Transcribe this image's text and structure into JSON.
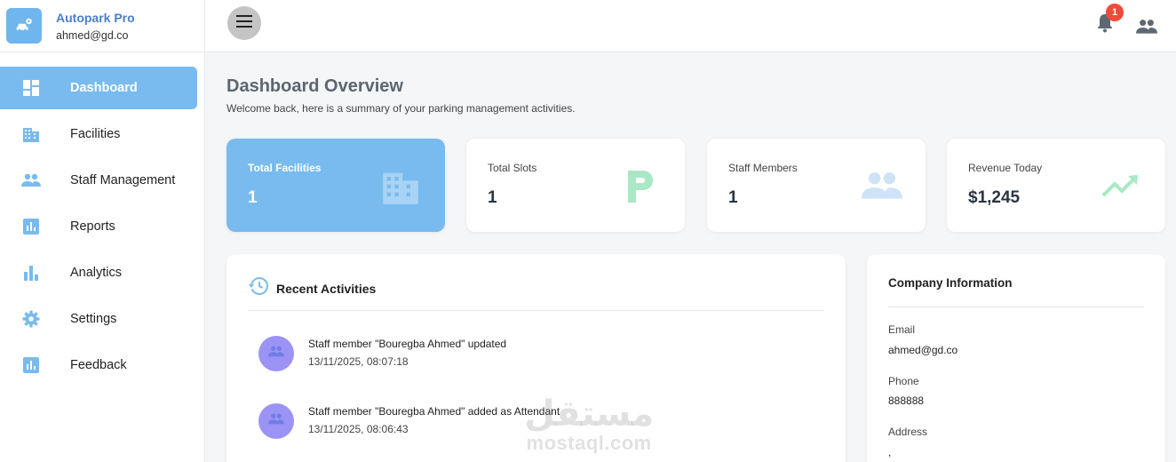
{
  "brand": {
    "name": "Autopark Pro",
    "email": "ahmed@gd.co",
    "logo_icon": "car-settings-icon"
  },
  "sidebar": {
    "items": [
      {
        "label": "Dashboard",
        "icon": "dashboard-icon",
        "active": true
      },
      {
        "label": "Facilities",
        "icon": "building-icon",
        "active": false
      },
      {
        "label": "Staff Management",
        "icon": "people-icon",
        "active": false
      },
      {
        "label": "Reports",
        "icon": "bar-chart-box-icon",
        "active": false
      },
      {
        "label": "Analytics",
        "icon": "bar-chart-icon",
        "active": false
      },
      {
        "label": "Settings",
        "icon": "gear-icon",
        "active": false
      },
      {
        "label": "Feedback",
        "icon": "bar-chart-box-icon",
        "active": false
      }
    ]
  },
  "topbar": {
    "menu_icon": "hamburger-menu-icon",
    "notification_count": "1",
    "notification_icon": "bell-icon",
    "account_icon": "people-icon"
  },
  "header": {
    "title": "Dashboard Overview",
    "subtitle": "Welcome back, here is a summary of your parking management activities."
  },
  "stats": [
    {
      "label": "Total Facilities",
      "value": "1",
      "icon": "building-icon"
    },
    {
      "label": "Total Slots",
      "value": "1",
      "icon": "parking-icon"
    },
    {
      "label": "Staff Members",
      "value": "1",
      "icon": "people-icon"
    },
    {
      "label": "Revenue Today",
      "value": "$1,245",
      "icon": "trending-up-icon"
    }
  ],
  "activities": {
    "title": "Recent Activities",
    "icon": "history-icon",
    "items": [
      {
        "message": "Staff member \"Bouregba Ahmed\" updated",
        "time": "13/11/2025, 08:07:18",
        "icon": "people-icon"
      },
      {
        "message": "Staff member \"Bouregba Ahmed\" added as Attendant",
        "time": "13/11/2025, 08:06:43",
        "icon": "people-icon"
      }
    ]
  },
  "company": {
    "title": "Company Information",
    "email_label": "Email",
    "email_value": "ahmed@gd.co",
    "phone_label": "Phone",
    "phone_value": "888888",
    "address_label": "Address",
    "address_value": ","
  },
  "watermark": {
    "arabic": "مستقل",
    "latin": "mostaql.com"
  },
  "colors": {
    "accent": "#79bbee",
    "brand_text": "#4a7fc9",
    "badge": "#ef4b3a",
    "avatar": "#9b93f5",
    "parking_green": "#a9e8c4"
  }
}
